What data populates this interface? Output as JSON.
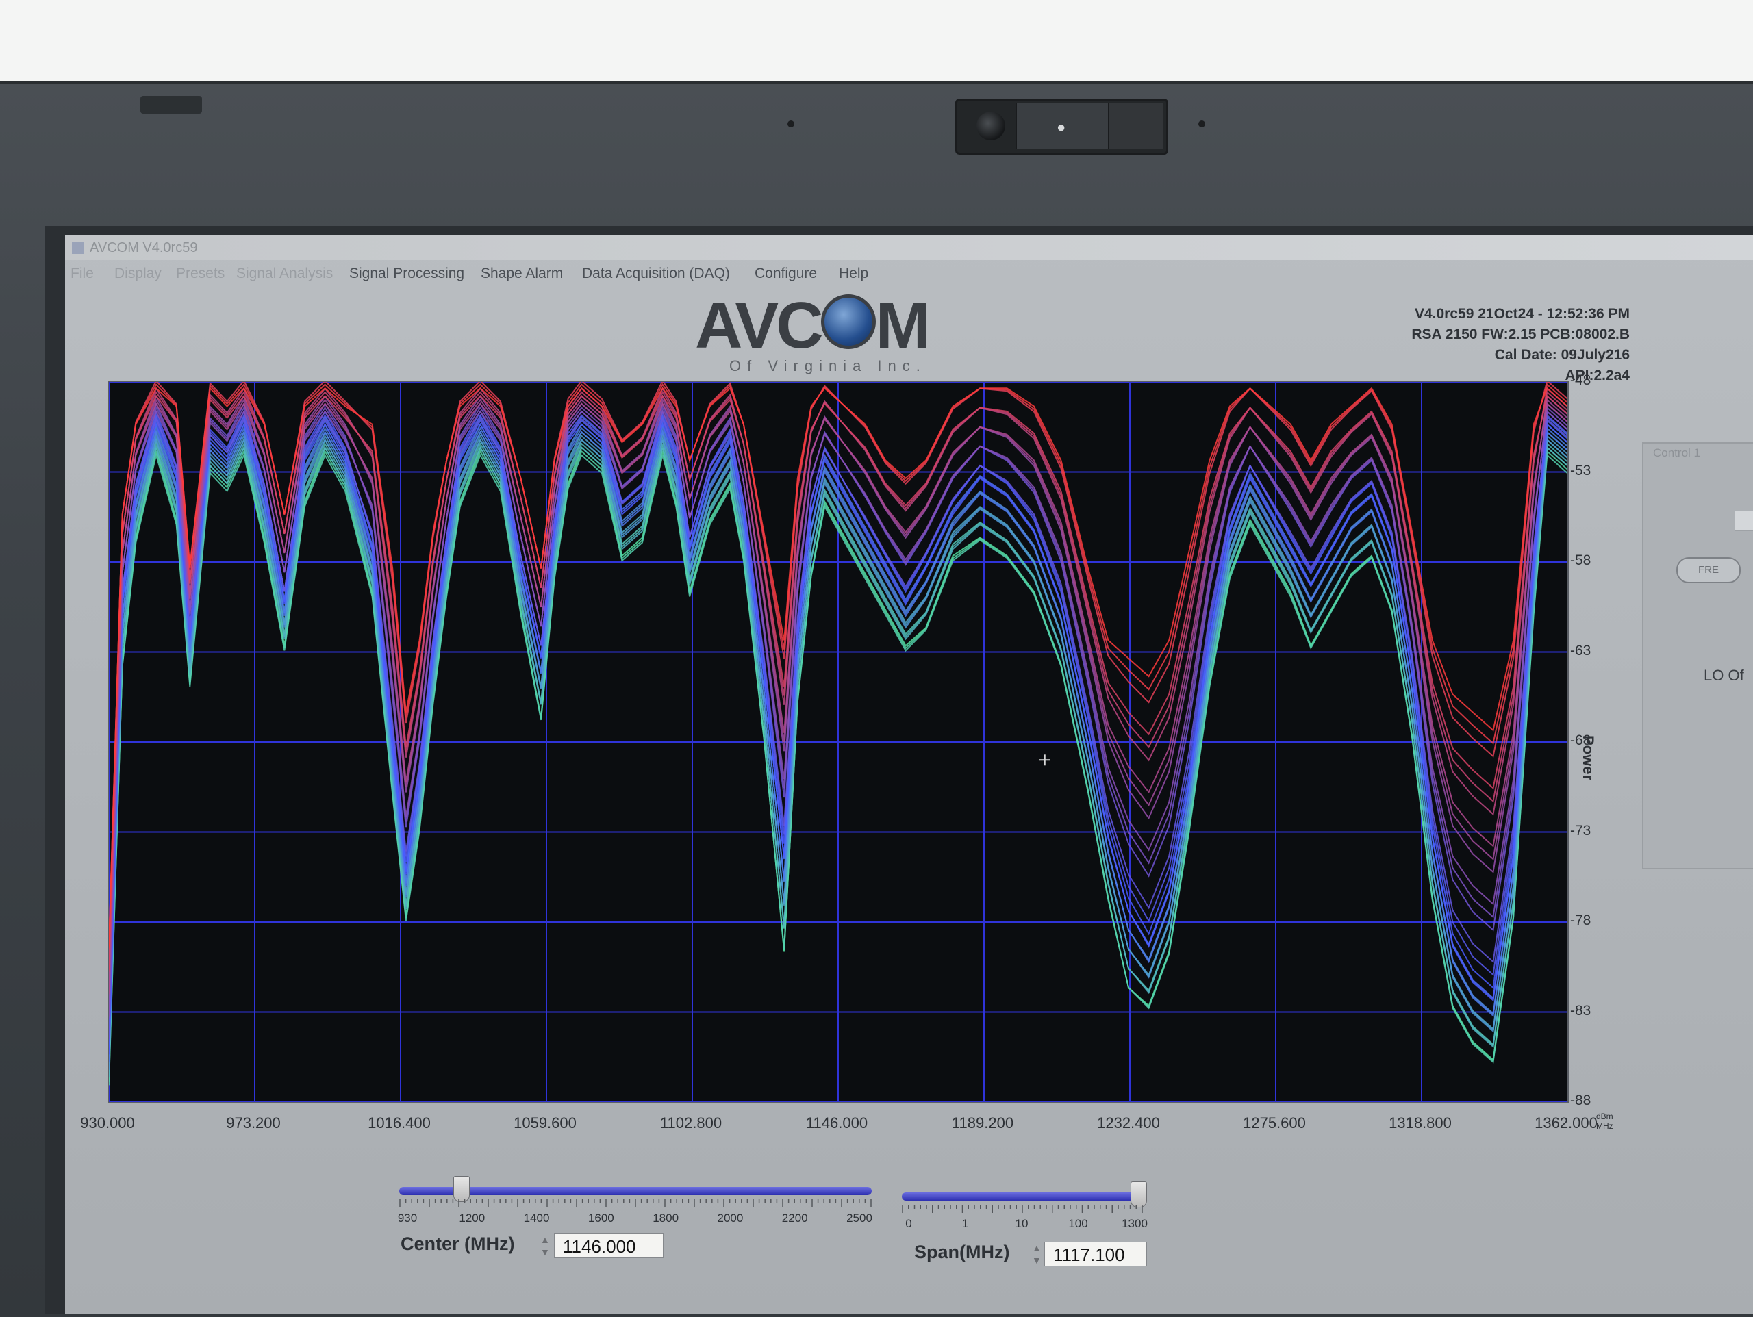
{
  "window": {
    "title": "AVCOM V4.0rc59"
  },
  "menu": [
    {
      "label": "File",
      "dim": true
    },
    {
      "label": "Display",
      "dim": true
    },
    {
      "label": "Presets",
      "dim": true
    },
    {
      "label": "Signal Analysis",
      "dim": true
    },
    {
      "label": "Signal Processing",
      "dim": false
    },
    {
      "label": "Shape Alarm",
      "dim": false
    },
    {
      "label": "Data Acquisition (DAQ)",
      "dim": false
    },
    {
      "label": "Configure",
      "dim": false
    },
    {
      "label": "Help",
      "dim": false
    }
  ],
  "logo": {
    "brand": "AVCOM",
    "subtitle": "Of Virginia Inc."
  },
  "info": {
    "line1": "V4.0rc59  21Oct24 - 12:52:36 PM",
    "line2": "RSA 2150 FW:2.15 PCB:08002.B",
    "line3": "Cal Date: 09July216",
    "line4": "API:2.2a4"
  },
  "side_panel": {
    "title": "Control 1",
    "button": "FRE",
    "lo_label": "LO Of"
  },
  "center": {
    "label": "Center (MHz)",
    "value": "1146.000",
    "scale": [
      "930",
      "1200",
      "1400",
      "1600",
      "1800",
      "2000",
      "2200",
      "2500"
    ],
    "position": 0.13
  },
  "span": {
    "label": "Span(MHz)",
    "value": "1117.100",
    "scale": [
      "0",
      "1",
      "10",
      "100",
      "1300"
    ],
    "position": 0.98
  },
  "chart_data": {
    "type": "line",
    "ylabel": "Power",
    "yunit": "dBm",
    "xunit": "MHz",
    "ylim": [
      -88,
      -48
    ],
    "xlim": [
      930.0,
      1362.0
    ],
    "yticks": [
      "-48",
      "-53",
      "-58",
      "-63",
      "-68",
      "-73",
      "-78",
      "-83",
      "-88"
    ],
    "xticks": [
      "930.000",
      "973.200",
      "1016.400",
      "1059.600",
      "1102.800",
      "1146.000",
      "1189.200",
      "1232.400",
      "1275.600",
      "1318.800",
      "1362.000"
    ],
    "grid": true,
    "series": [
      {
        "color": "#ff3b3b",
        "x": [
          930,
          934,
          938,
          944,
          950,
          954,
          960,
          965,
          970,
          976,
          982,
          988,
          994,
          1000,
          1008,
          1014,
          1018,
          1022,
          1026,
          1030,
          1034,
          1040,
          1046,
          1052,
          1058,
          1062,
          1066,
          1070,
          1076,
          1082,
          1088,
          1094,
          1098,
          1102,
          1108,
          1114,
          1118,
          1124,
          1130,
          1134,
          1138,
          1142,
          1148,
          1154,
          1160,
          1166,
          1172,
          1180,
          1188,
          1196,
          1204,
          1212,
          1220,
          1226,
          1232,
          1238,
          1244,
          1250,
          1256,
          1262,
          1268,
          1274,
          1280,
          1286,
          1292,
          1298,
          1304,
          1310,
          1316,
          1322,
          1328,
          1334,
          1340,
          1346,
          1352,
          1356,
          1362
        ],
        "y": [
          -79,
          -55,
          -50,
          -48,
          -49,
          -58,
          -48,
          -49,
          -48,
          -50,
          -55,
          -49,
          -48,
          -49,
          -50,
          -58,
          -66,
          -62,
          -56,
          -52,
          -49,
          -48,
          -49,
          -53,
          -58,
          -52,
          -49,
          -48,
          -49,
          -51,
          -50,
          -48,
          -49,
          -52,
          -49,
          -48,
          -50,
          -56,
          -62,
          -53,
          -49,
          -48,
          -49,
          -50,
          -52,
          -53,
          -52,
          -49,
          -48,
          -48,
          -49,
          -52,
          -58,
          -62,
          -63,
          -64,
          -62,
          -57,
          -52,
          -49,
          -48,
          -49,
          -50,
          -52,
          -50,
          -49,
          -48,
          -50,
          -56,
          -62,
          -65,
          -66,
          -67,
          -62,
          -50,
          -48,
          -49
        ]
      },
      {
        "color": "#4a5cff",
        "x": [
          930,
          934,
          938,
          944,
          950,
          954,
          960,
          965,
          970,
          976,
          982,
          988,
          994,
          1000,
          1008,
          1014,
          1018,
          1022,
          1026,
          1030,
          1034,
          1040,
          1046,
          1052,
          1058,
          1062,
          1066,
          1070,
          1076,
          1082,
          1088,
          1094,
          1098,
          1102,
          1108,
          1114,
          1118,
          1124,
          1130,
          1134,
          1138,
          1142,
          1148,
          1154,
          1160,
          1166,
          1172,
          1180,
          1188,
          1196,
          1204,
          1212,
          1220,
          1226,
          1232,
          1238,
          1244,
          1250,
          1256,
          1262,
          1268,
          1274,
          1280,
          1286,
          1292,
          1298,
          1304,
          1310,
          1316,
          1322,
          1328,
          1334,
          1340,
          1346,
          1352,
          1356,
          1362
        ],
        "y": [
          -85,
          -60,
          -54,
          -50,
          -53,
          -62,
          -51,
          -52,
          -50,
          -54,
          -60,
          -52,
          -50,
          -52,
          -57,
          -68,
          -75,
          -70,
          -63,
          -57,
          -52,
          -50,
          -52,
          -58,
          -63,
          -56,
          -51,
          -50,
          -51,
          -55,
          -54,
          -50,
          -52,
          -57,
          -53,
          -51,
          -55,
          -64,
          -74,
          -62,
          -55,
          -52,
          -54,
          -56,
          -58,
          -60,
          -58,
          -55,
          -53,
          -54,
          -56,
          -60,
          -67,
          -73,
          -77,
          -79,
          -76,
          -70,
          -62,
          -56,
          -53,
          -55,
          -57,
          -59,
          -57,
          -55,
          -54,
          -57,
          -64,
          -73,
          -79,
          -81,
          -82,
          -74,
          -58,
          -50,
          -51
        ]
      },
      {
        "color": "#54e3a0",
        "x": [
          930,
          934,
          938,
          944,
          950,
          954,
          960,
          965,
          970,
          976,
          982,
          988,
          994,
          1000,
          1008,
          1014,
          1018,
          1022,
          1026,
          1030,
          1034,
          1040,
          1046,
          1052,
          1058,
          1062,
          1066,
          1070,
          1076,
          1082,
          1088,
          1094,
          1098,
          1102,
          1108,
          1114,
          1118,
          1124,
          1130,
          1134,
          1138,
          1142,
          1148,
          1154,
          1160,
          1166,
          1172,
          1180,
          1188,
          1196,
          1204,
          1212,
          1220,
          1226,
          1232,
          1238,
          1244,
          1250,
          1256,
          1262,
          1268,
          1274,
          1280,
          1286,
          1292,
          1298,
          1304,
          1310,
          1316,
          1322,
          1328,
          1334,
          1340,
          1346,
          1352,
          1356,
          1362
        ],
        "y": [
          -87,
          -64,
          -57,
          -52,
          -56,
          -65,
          -53,
          -54,
          -52,
          -57,
          -63,
          -55,
          -52,
          -54,
          -60,
          -71,
          -78,
          -73,
          -66,
          -60,
          -55,
          -52,
          -54,
          -61,
          -67,
          -59,
          -54,
          -52,
          -53,
          -58,
          -57,
          -52,
          -55,
          -60,
          -56,
          -54,
          -58,
          -68,
          -80,
          -66,
          -59,
          -55,
          -57,
          -59,
          -61,
          -63,
          -62,
          -58,
          -57,
          -58,
          -60,
          -64,
          -71,
          -77,
          -82,
          -83,
          -80,
          -73,
          -65,
          -59,
          -56,
          -58,
          -60,
          -63,
          -61,
          -59,
          -58,
          -61,
          -68,
          -77,
          -83,
          -85,
          -86,
          -78,
          -61,
          -52,
          -53
        ]
      }
    ]
  }
}
